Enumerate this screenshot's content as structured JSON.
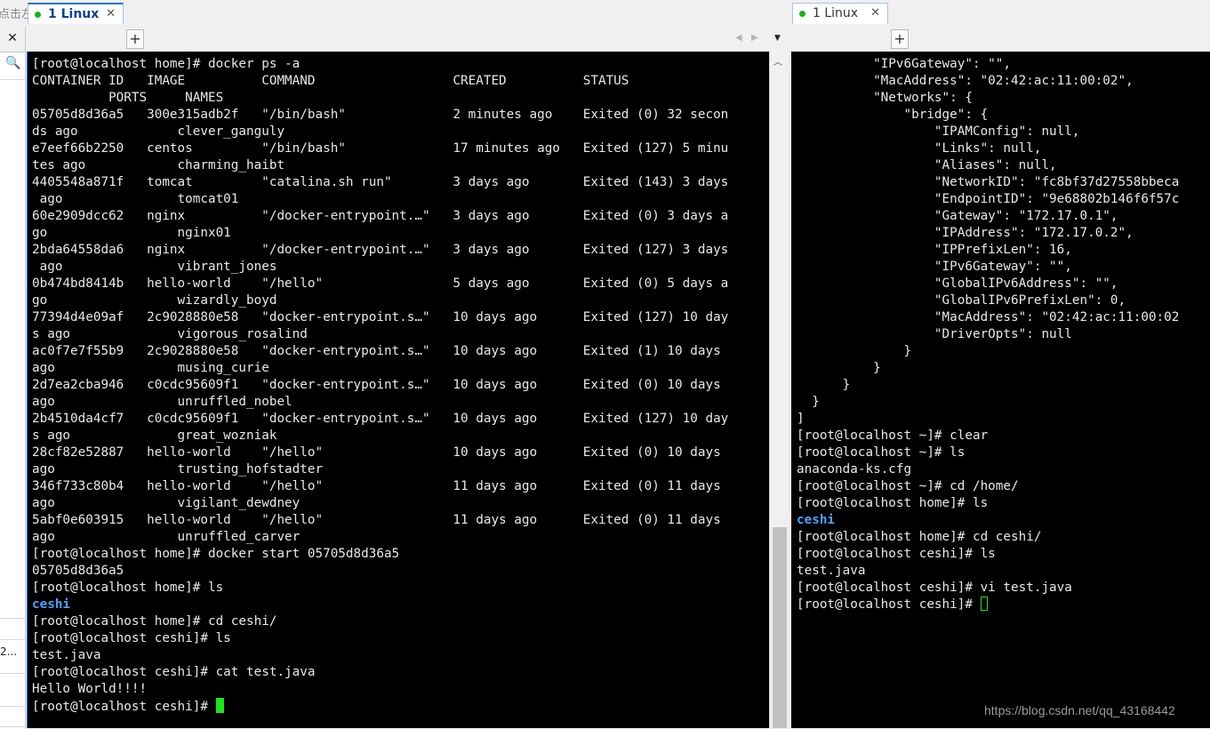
{
  "window": {
    "hint_text": "点击左侧的箭头按钮。",
    "left_panel": {
      "close_glyph": "✕",
      "search_glyph": "🔍",
      "truncated_label": "2..."
    }
  },
  "tabs_left": [
    {
      "label": "1 Linux",
      "close_glyph": "✕",
      "active": true
    }
  ],
  "tabs_right": [
    {
      "label": "1 Linux",
      "close_glyph": "✕",
      "active": false
    }
  ],
  "tab_controls": {
    "add_label": "+",
    "prev_glyph": "◀",
    "next_glyph": "▶",
    "menu_glyph": "▼"
  },
  "colors": {
    "cursor": "#19e619",
    "directory": "#4aa3ff",
    "status_dot": "#16b516",
    "terminal_bg": "#000000"
  },
  "left_terminal": {
    "lines": [
      "[root@localhost home]# docker ps -a",
      "CONTAINER ID   IMAGE          COMMAND                  CREATED          STATUS",
      "          PORTS     NAMES",
      "05705d8d36a5   300e315adb2f   \"/bin/bash\"              2 minutes ago    Exited (0) 32 secon",
      "ds ago             clever_ganguly",
      "e7eef66b2250   centos         \"/bin/bash\"              17 minutes ago   Exited (127) 5 minu",
      "tes ago            charming_haibt",
      "4405548a871f   tomcat         \"catalina.sh run\"        3 days ago       Exited (143) 3 days",
      " ago               tomcat01",
      "60e2909dcc62   nginx          \"/docker-entrypoint.…\"   3 days ago       Exited (0) 3 days a",
      "go                 nginx01",
      "2bda64558da6   nginx          \"/docker-entrypoint.…\"   3 days ago       Exited (127) 3 days",
      " ago               vibrant_jones",
      "0b474bd8414b   hello-world    \"/hello\"                 5 days ago       Exited (0) 5 days a",
      "go                 wizardly_boyd",
      "77394d4e09af   2c9028880e58   \"docker-entrypoint.s…\"   10 days ago      Exited (127) 10 day",
      "s ago              vigorous_rosalind",
      "ac0f7e7f55b9   2c9028880e58   \"docker-entrypoint.s…\"   10 days ago      Exited (1) 10 days",
      "ago                musing_curie",
      "2d7ea2cba946   c0cdc95609f1   \"docker-entrypoint.s…\"   10 days ago      Exited (0) 10 days",
      "ago                unruffled_nobel",
      "2b4510da4cf7   c0cdc95609f1   \"docker-entrypoint.s…\"   10 days ago      Exited (127) 10 day",
      "s ago              great_wozniak",
      "28cf82e52887   hello-world    \"/hello\"                 10 days ago      Exited (0) 10 days",
      "ago                trusting_hofstadter",
      "346f733c80b4   hello-world    \"/hello\"                 11 days ago      Exited (0) 11 days",
      "ago                vigilant_dewdney",
      "5abf0e603915   hello-world    \"/hello\"                 11 days ago      Exited (0) 11 days",
      "ago                unruffled_carver",
      "[root@localhost home]# docker start 05705d8d36a5",
      "05705d8d36a5",
      "[root@localhost home]# ls",
      "ceshi",
      "[root@localhost home]# cd ceshi/",
      "[root@localhost ceshi]# ls",
      "test.java",
      "[root@localhost ceshi]# cat test.java",
      "Hello World!!!!",
      "[root@localhost ceshi]# "
    ],
    "dir_line_indexes": [
      32
    ]
  },
  "right_terminal": {
    "lines": [
      "          \"IPv6Gateway\": \"\",",
      "          \"MacAddress\": \"02:42:ac:11:00:02\",",
      "          \"Networks\": {",
      "              \"bridge\": {",
      "                  \"IPAMConfig\": null,",
      "                  \"Links\": null,",
      "                  \"Aliases\": null,",
      "                  \"NetworkID\": \"fc8bf37d27558bbeca",
      "                  \"EndpointID\": \"9e68802b146f6f57c",
      "                  \"Gateway\": \"172.17.0.1\",",
      "                  \"IPAddress\": \"172.17.0.2\",",
      "                  \"IPPrefixLen\": 16,",
      "                  \"IPv6Gateway\": \"\",",
      "                  \"GlobalIPv6Address\": \"\",",
      "                  \"GlobalIPv6PrefixLen\": 0,",
      "                  \"MacAddress\": \"02:42:ac:11:00:02",
      "                  \"DriverOpts\": null",
      "              }",
      "          }",
      "      }",
      "  }",
      "]",
      "[root@localhost ~]# clear",
      "[root@localhost ~]# ls",
      "anaconda-ks.cfg",
      "[root@localhost ~]# cd /home/",
      "[root@localhost home]# ls",
      "ceshi",
      "[root@localhost home]# cd ceshi/",
      "[root@localhost ceshi]# ls",
      "test.java",
      "[root@localhost ceshi]# vi test.java",
      "[root@localhost ceshi]# "
    ],
    "dir_line_indexes": [
      27
    ]
  },
  "watermark": "https://blog.csdn.net/qq_43168442"
}
